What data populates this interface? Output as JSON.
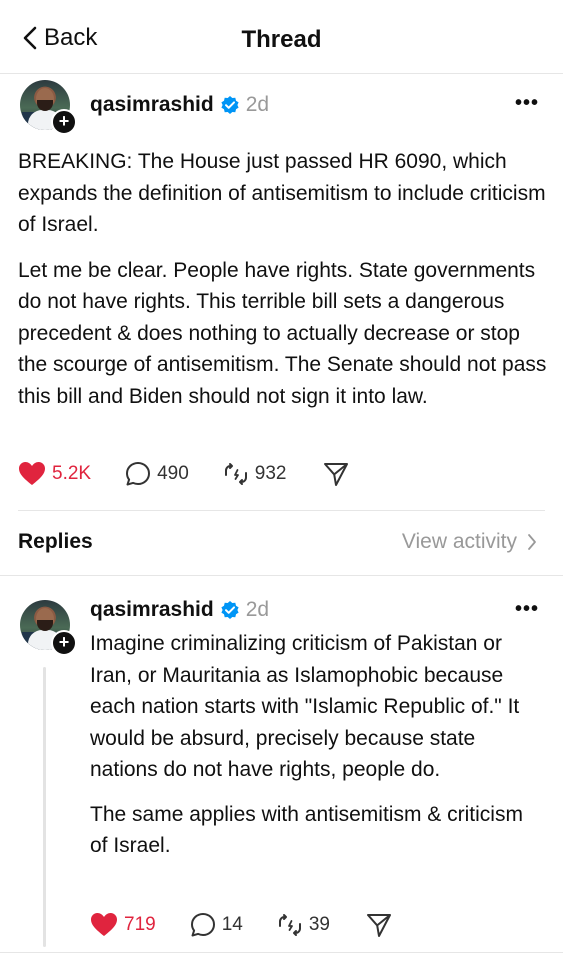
{
  "header": {
    "back_label": "Back",
    "title": "Thread"
  },
  "post": {
    "username": "qasimrashid",
    "time": "2d",
    "paragraphs": [
      "BREAKING: The House just passed HR 6090, which expands the definition of antisemitism to include criticism of Israel.",
      "Let me be clear. People have rights. State governments do not have rights. This terrible bill sets a dangerous precedent & does nothing to actually decrease or stop the scourge of antisemitism. The Senate should not pass this bill and Biden should not sign it into law."
    ],
    "likes": "5.2K",
    "replies": "490",
    "reposts": "932"
  },
  "replies_section": {
    "label": "Replies",
    "view_activity": "View activity"
  },
  "reply": {
    "username": "qasimrashid",
    "time": "2d",
    "paragraphs": [
      "Imagine criminalizing criticism of Pakistan or Iran, or Mauritania as Islamophobic because each nation starts with \"Islamic Republic of.\" It would be absurd, precisely because state nations do not have rights, people do.",
      "The same applies with antisemitism & criticism of Israel."
    ],
    "likes": "719",
    "replies": "14",
    "reposts": "39"
  },
  "colors": {
    "like_red": "#e0243e",
    "verified_blue": "#0095f6",
    "muted_gray": "#999999"
  }
}
